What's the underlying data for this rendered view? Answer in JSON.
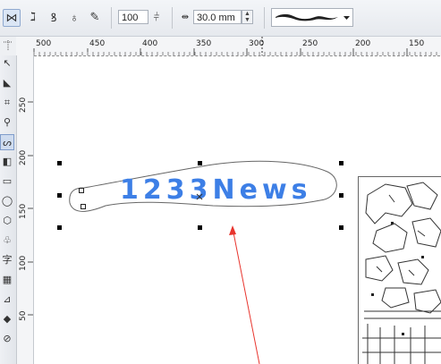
{
  "property_bar": {
    "tools": [
      {
        "name": "envelope-mode",
        "glyph": "⋈"
      },
      {
        "name": "pressure-brush",
        "glyph": "ℷ"
      },
      {
        "name": "calligraphic-pen",
        "glyph": "ꝸ"
      },
      {
        "name": "artistic-nib",
        "glyph": "♁"
      },
      {
        "name": "brush-stroke",
        "glyph": "✎"
      }
    ],
    "smoothing_value": "100",
    "width_value": "30.0 mm",
    "stroke_preset_label": "brush stroke preset"
  },
  "ruler_h": {
    "labels": [
      "500",
      "450",
      "400",
      "350",
      "300",
      "250",
      "200",
      "150"
    ]
  },
  "ruler_v": {
    "labels": [
      "250",
      "200",
      "150",
      "100",
      "50"
    ]
  },
  "canvas": {
    "text_on_path": "1233News",
    "text_color": "#3d7fe6",
    "arrow_color": "#e8352e"
  }
}
